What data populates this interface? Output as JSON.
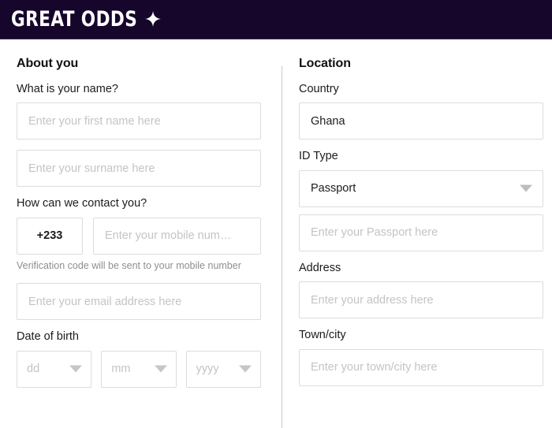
{
  "header": {
    "brand_name": "GREAT ODDS",
    "star_icon": "sparkle-icon",
    "background_color": "#16062b"
  },
  "about_you": {
    "section_title": "About you",
    "name_label": "What is your name?",
    "first_name_placeholder": "Enter your first name here",
    "surname_placeholder": "Enter your surname here",
    "contact_label": "How can we contact you?",
    "country_code": "+233",
    "mobile_placeholder": "Enter your mobile num…",
    "verification_help": "Verification code will be sent to your mobile number",
    "email_placeholder": "Enter your email address here",
    "dob_label": "Date of birth",
    "dob_day_placeholder": "dd",
    "dob_month_placeholder": "mm",
    "dob_year_placeholder": "yyyy"
  },
  "location": {
    "section_title": "Location",
    "country_label": "Country",
    "country_value": "Ghana",
    "id_type_label": "ID Type",
    "id_type_value": "Passport",
    "id_number_placeholder": "Enter your Passport here",
    "address_label": "Address",
    "address_placeholder": "Enter your address here",
    "town_label": "Town/city",
    "town_placeholder": "Enter your town/city here"
  }
}
